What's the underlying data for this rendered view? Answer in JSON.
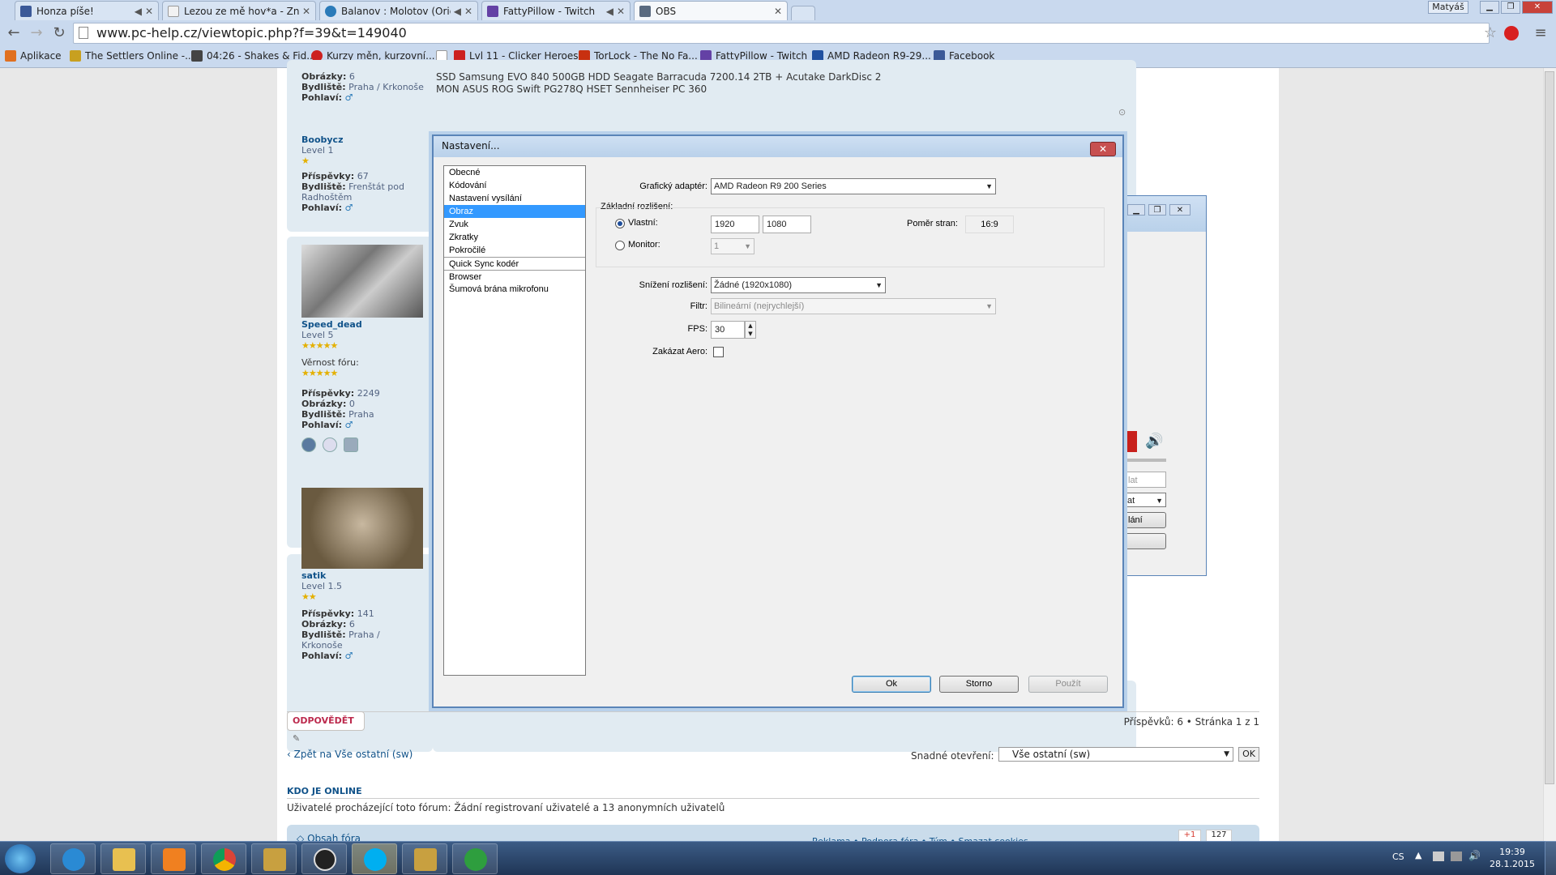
{
  "browser": {
    "tabs": [
      {
        "label": "Honza píše!",
        "icon_color": "#3b5998",
        "has_audio": true
      },
      {
        "label": "Lezou ze mě hov*a - Znud",
        "icon_color": "#f2f2f2",
        "has_audio": false
      },
      {
        "label": "Balanov : Molotov (Origin",
        "icon_color": "#2b7bb9",
        "has_audio": true
      },
      {
        "label": "FattyPillow - Twitch",
        "icon_color": "#6441a5",
        "has_audio": true
      },
      {
        "label": "OBS",
        "icon_color": "#333333",
        "has_audio": false,
        "active": true
      }
    ],
    "user_button": "Matyáš",
    "url": "www.pc-help.cz/viewtopic.php?f=39&t=149040",
    "bookmarks": [
      {
        "label": "Aplikace",
        "icon_color": "#e07020"
      },
      {
        "label": "The Settlers Online -...",
        "icon_color": "#c8a020"
      },
      {
        "label": "04:26 - Shakes & Fid...",
        "icon_color": "#444444"
      },
      {
        "label": "Kurzy měn, kurzovní...",
        "icon_color": "#cc2020"
      },
      {
        "label": "Lvl 11 - Clicker Heroes",
        "icon_color": "#cc2020"
      },
      {
        "label": "TorLock - The No Fa...",
        "icon_color": "#c83010"
      },
      {
        "label": "FattyPillow - Twitch",
        "icon_color": "#6441a5"
      },
      {
        "label": "AMD Radeon R9-29...",
        "icon_color": "#2050a0"
      },
      {
        "label": "Facebook",
        "icon_color": "#3b5998"
      }
    ]
  },
  "forum": {
    "post1": {
      "obrazky_label": "Obrázky:",
      "obrazky_value": "6",
      "bydliste_label": "Bydliště:",
      "bydliste_value": "Praha / Krkonoše",
      "pohlavi_label": "Pohlaví:",
      "spec_line1": "SSD Samsung EVO 840 500GB HDD Seagate Barracuda 7200.14 2TB + Acutake DarkDisc 2",
      "spec_line2": "MON ASUS ROG Swift PG278Q HSET Sennheiser PC 360"
    },
    "post2": {
      "name": "Boobycz",
      "level": "Level 1",
      "prispevky_label": "Příspěvky:",
      "prispevky_value": "67",
      "bydliste_label": "Bydliště:",
      "bydliste_value": "Frenštát pod Radhoštěm",
      "pohlavi_label": "Pohlaví:"
    },
    "post3": {
      "name": "Speed_dead",
      "level": "Level 5",
      "vernost_label": "Věrnost fóru:",
      "prispevky_label": "Příspěvky:",
      "prispevky_value": "2249",
      "obrazky_label": "Obrázky:",
      "obrazky_value": "0",
      "bydliste_label": "Bydliště:",
      "bydliste_value": "Praha",
      "pohlavi_label": "Pohlaví:"
    },
    "post4": {
      "name": "satik",
      "level": "Level 1.5",
      "prispevky_label": "Příspěvky:",
      "prispevky_value": "141",
      "obrazky_label": "Obrázky:",
      "obrazky_value": "6",
      "bydliste_label": "Bydliště:",
      "bydliste_value": "Praha / Krkonoše",
      "pohlavi_label": "Pohlaví:"
    },
    "reply_button": "ODPOVĚDĚT",
    "pagination": "Příspěvků: 6 • Stránka 1 z 1",
    "back_link": "Zpět na Vše ostatní (sw)",
    "jump_label": "Snadné otevření:",
    "jump_value": "Vše ostatní (sw)",
    "jump_ok": "OK",
    "online_heading": "KDO JE ONLINE",
    "online_text": "Uživatelé procházející toto fórum: Žádní registrovaní uživatelé a 13 anonymních uživatelů",
    "footer_link": "Obsah fóra",
    "footer_right": "Reklama • Podpora fóra • Tým • Smazat cookies",
    "gplus": "+1",
    "gplus_count": "127"
  },
  "dialog": {
    "title": "Nastavení...",
    "categories": [
      "Obecné",
      "Kódování",
      "Nastavení vysílání",
      "Obraz",
      "Zvuk",
      "Zkratky",
      "Pokročilé",
      "Quick Sync kodér",
      "Browser",
      "Šumová brána mikrofonu"
    ],
    "selected_category": "Obraz",
    "adapter_label": "Grafický adaptér:",
    "adapter_value": "AMD Radeon R9 200 Series",
    "base_res_label": "Základní rozlišení:",
    "custom_label": "Vlastní:",
    "width": "1920",
    "height": "1080",
    "aspect_label": "Poměr stran:",
    "aspect_value": "16:9",
    "monitor_label": "Monitor:",
    "monitor_value": "1",
    "downscale_label": "Snížení rozlišení:",
    "downscale_value": "Žádné  (1920x1080)",
    "filter_label": "Filtr:",
    "filter_value": "Bilineární (nejrychlejší)",
    "fps_label": "FPS:",
    "fps_value": "30",
    "aero_label": "Zakázat Aero:",
    "ok": "Ok",
    "cancel": "Storno",
    "apply": "Použít"
  },
  "obs_window": {
    "field1": "lat",
    "combo1": "at",
    "button1": "lání"
  },
  "taskbar": {
    "apps": [
      {
        "name": "ie",
        "color": "#2a8ad4"
      },
      {
        "name": "explorer",
        "color": "#e8c050"
      },
      {
        "name": "media-player",
        "color": "#f08020"
      },
      {
        "name": "chrome",
        "color": "#4caf50"
      },
      {
        "name": "league",
        "color": "#c8a040"
      },
      {
        "name": "obs",
        "color": "#222222"
      },
      {
        "name": "skype",
        "color": "#00aff0"
      },
      {
        "name": "league2",
        "color": "#c8a040"
      },
      {
        "name": "utorrent",
        "color": "#2e9e3e"
      }
    ],
    "lang": "CS",
    "time": "19:39",
    "date": "28.1.2015"
  }
}
